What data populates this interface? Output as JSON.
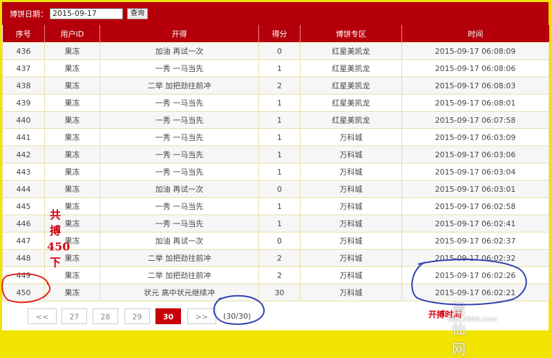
{
  "filter": {
    "label": "博饼日期：",
    "date_value": "2015-09-17",
    "query_button": "查询"
  },
  "table": {
    "headers": [
      "序号",
      "用户ID",
      "开得",
      "得分",
      "博饼专区",
      "时间"
    ],
    "rows": [
      [
        "436",
        "果冻",
        "加油 再试一次",
        "0",
        "红星美凯龙",
        "2015-09-17 06:08:09"
      ],
      [
        "437",
        "果冻",
        "一秀 一马当先",
        "1",
        "红星美凯龙",
        "2015-09-17 06:08:06"
      ],
      [
        "438",
        "果冻",
        "二举 加把劲往前冲",
        "2",
        "红星美凯龙",
        "2015-09-17 06:08:03"
      ],
      [
        "439",
        "果冻",
        "一秀 一马当先",
        "1",
        "红星美凯龙",
        "2015-09-17 06:08:01"
      ],
      [
        "440",
        "果冻",
        "一秀 一马当先",
        "1",
        "红星美凯龙",
        "2015-09-17 06:07:58"
      ],
      [
        "441",
        "果冻",
        "一秀 一马当先",
        "1",
        "万科城",
        "2015-09-17 06:03:09"
      ],
      [
        "442",
        "果冻",
        "一秀 一马当先",
        "1",
        "万科城",
        "2015-09-17 06:03:06"
      ],
      [
        "443",
        "果冻",
        "一秀 一马当先",
        "1",
        "万科城",
        "2015-09-17 06:03:04"
      ],
      [
        "444",
        "果冻",
        "加油 再试一次",
        "0",
        "万科城",
        "2015-09-17 06:03:01"
      ],
      [
        "445",
        "果冻",
        "一秀 一马当先",
        "1",
        "万科城",
        "2015-09-17 06:02:58"
      ],
      [
        "446",
        "果冻",
        "一秀 一马当先",
        "1",
        "万科城",
        "2015-09-17 06:02:41"
      ],
      [
        "447",
        "果冻",
        "加油 再试一次",
        "0",
        "万科城",
        "2015-09-17 06:02:37"
      ],
      [
        "448",
        "果冻",
        "二举 加把劲往前冲",
        "2",
        "万科城",
        "2015-09-17 06:02:32"
      ],
      [
        "449",
        "果冻",
        "二举 加把劲往前冲",
        "2",
        "万科城",
        "2015-09-17 06:02:26"
      ],
      [
        "450",
        "果冻",
        "状元 高中状元继续冲",
        "30",
        "万科城",
        "2015-09-17 06:02:21"
      ]
    ]
  },
  "pagination": {
    "prev": "<<",
    "pages": [
      "27",
      "28",
      "29",
      "30"
    ],
    "current": "30",
    "next": ">>",
    "info": "(30/30)"
  },
  "annotations": {
    "total_vertical": [
      "共",
      "搏",
      "450",
      "下"
    ],
    "open_time": "开搏时间",
    "color": "#d0000f",
    "circle_colors": [
      "#e0201a",
      "#2b3fb0"
    ]
  },
  "watermark": {
    "logo": "莆仙网",
    "url": "bbs.0594.com"
  },
  "colors": {
    "header_red": "#b5000b",
    "page_border": "#f2e300",
    "active_page": "#c8000a"
  }
}
